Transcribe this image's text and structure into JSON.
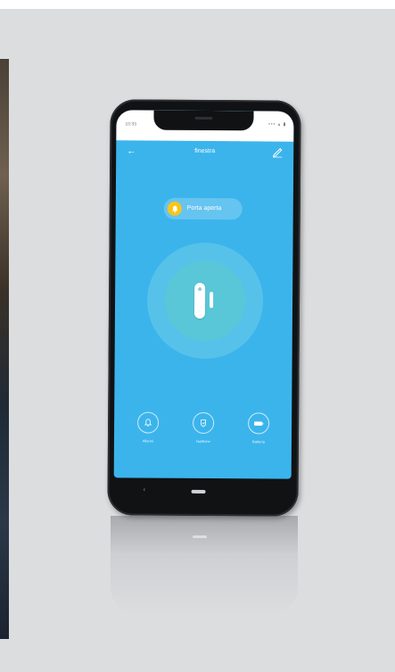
{
  "colors": {
    "screen_bg": "#3bb4ec",
    "alert_yellow": "#f7c51a",
    "page_bg": "#dcdddf",
    "phone_body": "#101214"
  },
  "status_bar": {
    "time": "10:33",
    "icons": "••• ▴ ▮"
  },
  "header": {
    "title": "finestra",
    "back_icon": "←",
    "edit_icon": "pencil-icon"
  },
  "status_pill": {
    "label": "Porta aperta",
    "icon": "bell-icon"
  },
  "actions": [
    {
      "label": "Allarmi",
      "icon": "bell-icon"
    },
    {
      "label": "Notifiche",
      "icon": "shield-icon"
    },
    {
      "label": "Batteria",
      "icon": "battery-icon"
    }
  ],
  "nav": {
    "back_glyph": "‹"
  }
}
